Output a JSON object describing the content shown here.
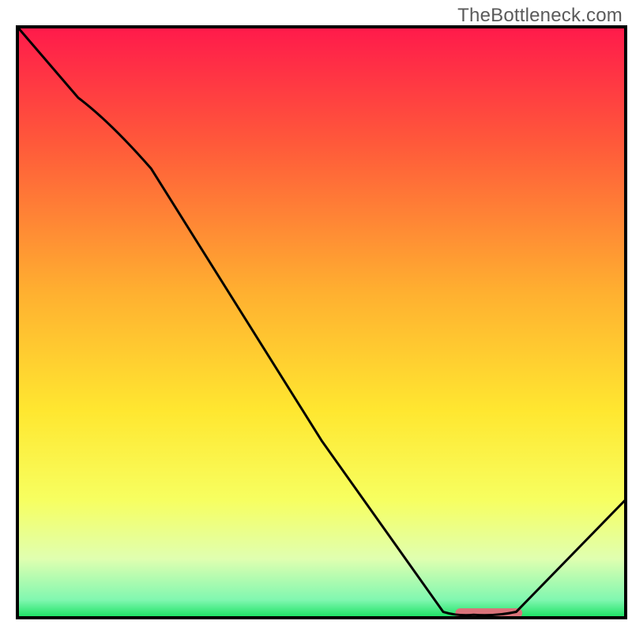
{
  "watermark": "TheBottleneck.com",
  "chart_data": {
    "type": "line",
    "title": "",
    "xlabel": "",
    "ylabel": "",
    "xlim": [
      0,
      100
    ],
    "ylim": [
      0,
      100
    ],
    "series": [
      {
        "name": "curve",
        "x": [
          0,
          10,
          22,
          50,
          70,
          75,
          82,
          100
        ],
        "y": [
          100,
          88,
          76,
          30,
          1,
          0.5,
          1,
          20
        ]
      }
    ],
    "marker": {
      "x_start": 72,
      "x_end": 83,
      "y": 0.8,
      "color": "#d9737a"
    },
    "gradient_stops": [
      {
        "offset": 0,
        "color": "#ff1a4b"
      },
      {
        "offset": 20,
        "color": "#ff5a3a"
      },
      {
        "offset": 45,
        "color": "#ffb030"
      },
      {
        "offset": 65,
        "color": "#ffe730"
      },
      {
        "offset": 80,
        "color": "#f7ff60"
      },
      {
        "offset": 90,
        "color": "#e0ffb0"
      },
      {
        "offset": 97,
        "color": "#80f7b0"
      },
      {
        "offset": 100,
        "color": "#18e060"
      }
    ],
    "frame_color": "#000000",
    "line_color": "#000000",
    "line_width": 3
  }
}
